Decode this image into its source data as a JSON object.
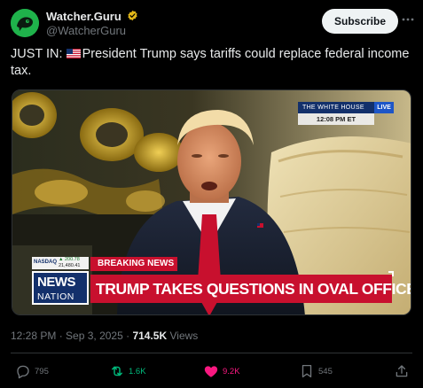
{
  "account": {
    "display_name": "Watcher.Guru",
    "handle": "@WatcherGuru",
    "subscribe_label": "Subscribe"
  },
  "icons": {
    "avatar": "watcher-guru-logo",
    "verified": "verified-badge-icon",
    "more": "more-horizontal-icon",
    "flag": "us-flag",
    "reply": "reply-icon",
    "repost": "repost-icon",
    "like": "heart-icon",
    "bookmark": "bookmark-icon",
    "share": "share-icon"
  },
  "tweet": {
    "text": "JUST IN: 🇺🇸 President Trump says tariffs could replace federal income tax.",
    "prefix": "JUST IN:",
    "body": "President Trump says tariffs could replace federal income tax."
  },
  "media": {
    "network_tag": "THE WHITE HOUSE",
    "live_label": "LIVE",
    "time": "12:08 PM ET",
    "nasdaq_label": "NASDAQ",
    "nasdaq_change": "▲ 200.78",
    "nasdaq_value": "21,480.41",
    "breaking": "BREAKING NEWS",
    "logo_top": "NEWS",
    "logo_bottom": "NATION",
    "headline": "TRUMP TAKES QUESTIONS IN OVAL OFFICE"
  },
  "meta": {
    "time": "12:28 PM",
    "sep": " · ",
    "date": "Sep 3, 2025",
    "sep2": " · ",
    "views_count": "714.5K",
    "views_label": " Views"
  },
  "actions": {
    "replies": "795",
    "reposts": "1.6K",
    "likes": "9.2K",
    "bookmarks": "545"
  },
  "colors": {
    "background": "#000000",
    "text": "#e7e9ea",
    "muted": "#71767b",
    "repost_active": "#00ba7c",
    "like_active": "#f91880",
    "verified_gold": "#e2b719",
    "breaking_red": "#c8102e",
    "nation_blue": "#13306b"
  }
}
